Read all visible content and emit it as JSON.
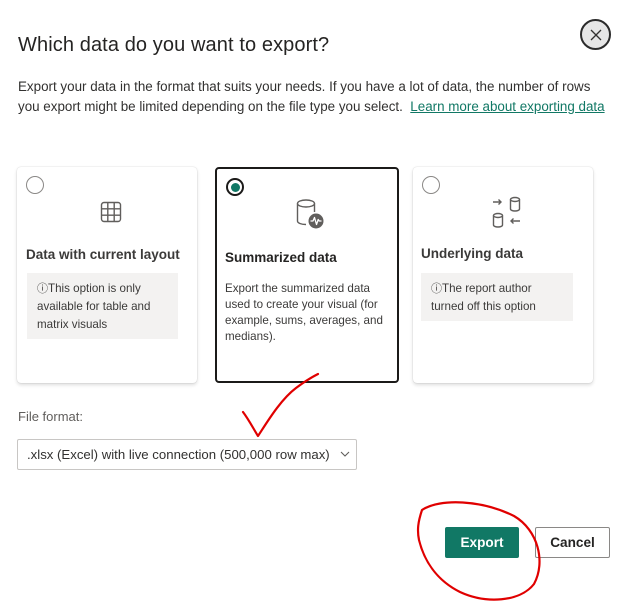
{
  "dialog": {
    "title": "Which data do you want to export?",
    "description": "Export your data in the format that suits your needs. If you have a lot of data, the number of rows you export might be limited depending on the file type you select.",
    "learn_more_link": "Learn more about exporting data"
  },
  "options": [
    {
      "title": "Data with current layout",
      "selected": false,
      "icon": "table-grid-icon",
      "info_icon": "ⓘ",
      "info_text": "This option is only available for table and matrix visuals"
    },
    {
      "title": "Summarized data",
      "selected": true,
      "icon": "database-pulse-icon",
      "description": "Export the summarized data used to create your visual (for example, sums, averages, and medians)."
    },
    {
      "title": "Underlying data",
      "selected": false,
      "icon": "database-sync-icon",
      "info_icon": "ⓘ",
      "info_text": "The report author turned off this option"
    }
  ],
  "file_format": {
    "label": "File format:",
    "selected": ".xlsx (Excel) with live connection (500,000 row max)"
  },
  "buttons": {
    "export": "Export",
    "cancel": "Cancel"
  },
  "colors": {
    "accent": "#117865",
    "annotation": "#e00000"
  }
}
